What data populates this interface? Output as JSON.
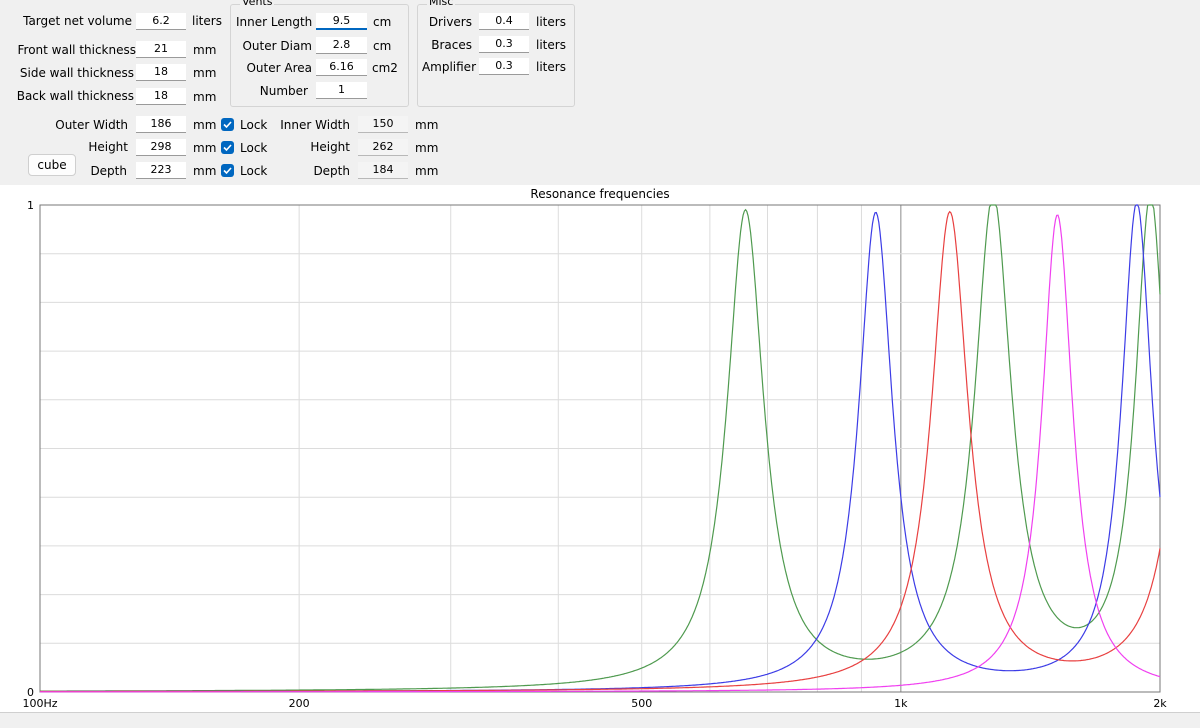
{
  "main": {
    "target_net_volume": {
      "label": "Target net volume",
      "value": "6.2",
      "unit": "liters"
    },
    "front_wall": {
      "label": "Front wall thickness",
      "value": "21",
      "unit": "mm"
    },
    "side_wall": {
      "label": "Side wall thickness",
      "value": "18",
      "unit": "mm"
    },
    "back_wall": {
      "label": "Back wall thickness",
      "value": "18",
      "unit": "mm"
    }
  },
  "vents": {
    "title": "Vents",
    "inner_length": {
      "label": "Inner Length",
      "value": "9.5",
      "unit": "cm"
    },
    "outer_diam": {
      "label": "Outer Diam",
      "value": "2.8",
      "unit": "cm"
    },
    "outer_area": {
      "label": "Outer Area",
      "value": "6.16",
      "unit": "cm2"
    },
    "number": {
      "label": "Number",
      "value": "1"
    }
  },
  "misc": {
    "title": "Misc",
    "drivers": {
      "label": "Drivers",
      "value": "0.4",
      "unit": "liters"
    },
    "braces": {
      "label": "Braces",
      "value": "0.3",
      "unit": "liters"
    },
    "amplifier": {
      "label": "Amplifier",
      "value": "0.3",
      "unit": "liters"
    }
  },
  "dims": {
    "outer_width": {
      "label": "Outer Width",
      "value": "186",
      "unit": "mm",
      "lock": "Lock"
    },
    "height": {
      "label": "Height",
      "value": "298",
      "unit": "mm",
      "lock": "Lock"
    },
    "depth": {
      "label": "Depth",
      "value": "223",
      "unit": "mm",
      "lock": "Lock"
    },
    "inner_width": {
      "label": "Inner Width",
      "value": "150",
      "unit": "mm"
    },
    "inner_height": {
      "label": "Height",
      "value": "262",
      "unit": "mm"
    },
    "inner_depth": {
      "label": "Depth",
      "value": "184",
      "unit": "mm"
    },
    "cube_button": "cube"
  },
  "colors": {
    "accent": "#0067c0",
    "green": "#4f9a4f",
    "blue": "#3c3ce6",
    "red": "#e84040",
    "magenta": "#f040f0"
  },
  "chart_data": {
    "type": "line",
    "title": "Resonance frequencies",
    "xscale": "log",
    "xlim": [
      100,
      2000
    ],
    "ylim": [
      0,
      1
    ],
    "x_tick_labels": [
      {
        "value": 100,
        "label": "100Hz"
      },
      {
        "value": 200,
        "label": "200"
      },
      {
        "value": 500,
        "label": "500"
      },
      {
        "value": 1000,
        "label": "1k"
      },
      {
        "value": 2000,
        "label": "2k"
      }
    ],
    "y_tick_labels": [
      {
        "value": 1,
        "label": "1"
      },
      {
        "value": 0,
        "label": "0"
      }
    ],
    "grid": true,
    "series": [
      {
        "color": "#4f9a4f",
        "peaks": [
          {
            "f": 660,
            "peak": 0.98,
            "bw": 0.06
          },
          {
            "f": 1280,
            "peak": 1.0,
            "bw": 0.06
          },
          {
            "f": 1950,
            "peak": 1.0,
            "bw": 0.05
          }
        ]
      },
      {
        "color": "#3c3ce6",
        "peaks": [
          {
            "f": 935,
            "peak": 0.98,
            "bw": 0.055
          },
          {
            "f": 1880,
            "peak": 1.0,
            "bw": 0.05
          }
        ]
      },
      {
        "color": "#e84040",
        "peaks": [
          {
            "f": 1140,
            "peak": 0.978,
            "bw": 0.06
          },
          {
            "f": 2200,
            "peak": 1.0,
            "bw": 0.06
          }
        ]
      },
      {
        "color": "#f040f0",
        "peaks": [
          {
            "f": 1520,
            "peak": 0.98,
            "bw": 0.05
          }
        ]
      }
    ]
  }
}
